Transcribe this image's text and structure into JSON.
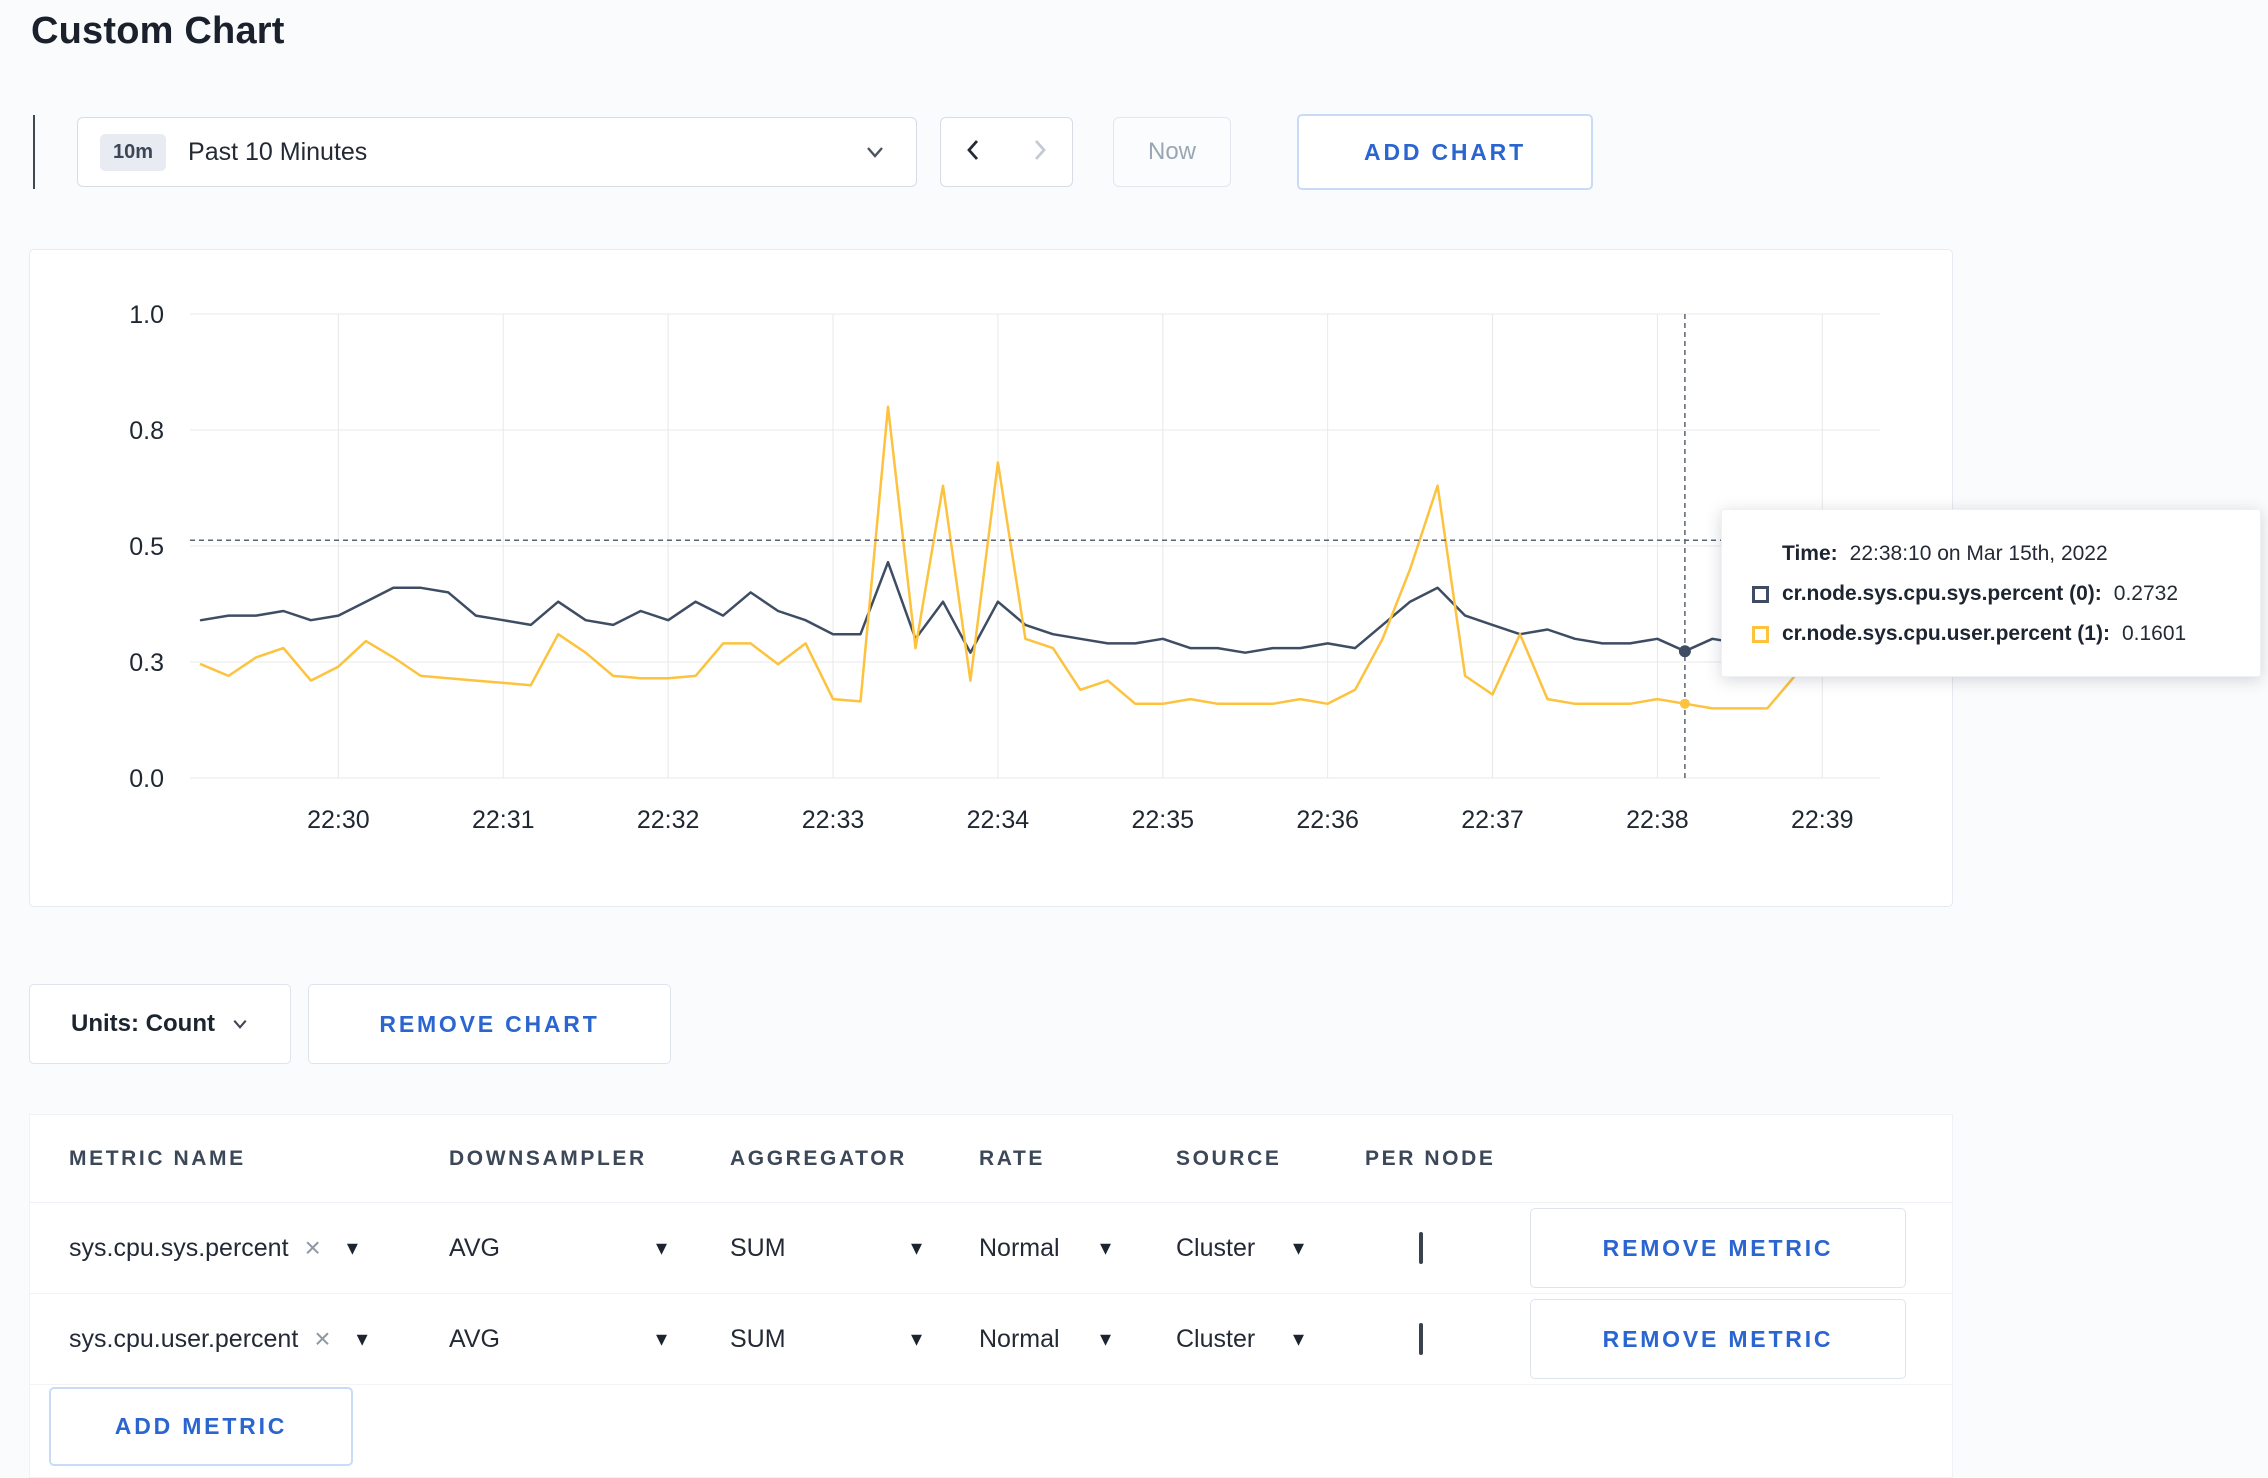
{
  "page": {
    "title": "Custom Chart",
    "accent": "#2a65d0",
    "background": "#fafbfc"
  },
  "icons": {
    "caret_down": "▾",
    "clear": "×"
  },
  "toolbar": {
    "time_window": {
      "badge": "10m",
      "label": "Past 10 Minutes"
    },
    "now_label": "Now",
    "add_chart_label": "ADD CHART"
  },
  "tooltip": {
    "time_label": "Time:",
    "time_value": "22:38:10 on Mar 15th, 2022",
    "series": [
      {
        "label": "cr.node.sys.cpu.sys.percent (0):",
        "value": "0.2732",
        "color": "#3e4d63"
      },
      {
        "label": "cr.node.sys.cpu.user.percent (1):",
        "value": "0.1601",
        "color": "#fdc23e"
      }
    ]
  },
  "units": {
    "label": "Units: Count",
    "remove_chart_label": "REMOVE CHART"
  },
  "metrics_table": {
    "headers": [
      "METRIC NAME",
      "DOWNSAMPLER",
      "AGGREGATOR",
      "RATE",
      "SOURCE",
      "PER NODE"
    ],
    "rows": [
      {
        "name": "sys.cpu.sys.percent",
        "downsampler": "AVG",
        "aggregator": "SUM",
        "rate": "Normal",
        "source": "Cluster",
        "per_node_checked": false,
        "remove_label": "REMOVE METRIC"
      },
      {
        "name": "sys.cpu.user.percent",
        "downsampler": "AVG",
        "aggregator": "SUM",
        "rate": "Normal",
        "source": "Cluster",
        "per_node_checked": false,
        "remove_label": "REMOVE METRIC"
      }
    ],
    "add_metric_label": "ADD METRIC"
  },
  "chart_data": {
    "type": "line",
    "x_domain_minutes": [
      29.1,
      39.35
    ],
    "y_domain": [
      0,
      1
    ],
    "x_start_minute": 29.1667,
    "x_step_minute": 0.166667,
    "grid": true,
    "legend_position": "tooltip",
    "y_ticks": [
      {
        "v": 0.0,
        "label": "0.0"
      },
      {
        "v": 0.25,
        "label": "0.3"
      },
      {
        "v": 0.5,
        "label": "0.5"
      },
      {
        "v": 0.75,
        "label": "0.8"
      },
      {
        "v": 1.0,
        "label": "1.0"
      }
    ],
    "x_ticks": [
      {
        "v": 30,
        "label": "22:30"
      },
      {
        "v": 31,
        "label": "22:31"
      },
      {
        "v": 32,
        "label": "22:32"
      },
      {
        "v": 33,
        "label": "22:33"
      },
      {
        "v": 34,
        "label": "22:34"
      },
      {
        "v": 35,
        "label": "22:35"
      },
      {
        "v": 36,
        "label": "22:36"
      },
      {
        "v": 37,
        "label": "22:37"
      },
      {
        "v": 38,
        "label": "22:38"
      },
      {
        "v": 39,
        "label": "22:39"
      }
    ],
    "series": [
      {
        "name": "cr.node.sys.cpu.sys.percent",
        "color": "#3e4d63",
        "values": [
          0.34,
          0.35,
          0.35,
          0.36,
          0.34,
          0.35,
          0.38,
          0.41,
          0.41,
          0.4,
          0.35,
          0.34,
          0.33,
          0.38,
          0.34,
          0.33,
          0.36,
          0.34,
          0.38,
          0.35,
          0.4,
          0.36,
          0.34,
          0.31,
          0.31,
          0.465,
          0.3,
          0.38,
          0.27,
          0.38,
          0.33,
          0.31,
          0.3,
          0.29,
          0.29,
          0.3,
          0.28,
          0.28,
          0.27,
          0.28,
          0.28,
          0.29,
          0.28,
          0.33,
          0.38,
          0.41,
          0.35,
          0.33,
          0.31,
          0.32,
          0.3,
          0.29,
          0.29,
          0.3,
          0.2732,
          0.3,
          0.29,
          0.29,
          0.3,
          0.31,
          0.3
        ]
      },
      {
        "name": "cr.node.sys.cpu.user.percent",
        "color": "#fdc23e",
        "values": [
          0.245,
          0.22,
          0.26,
          0.28,
          0.21,
          0.24,
          0.295,
          0.26,
          0.22,
          0.215,
          0.21,
          0.205,
          0.2,
          0.31,
          0.27,
          0.22,
          0.215,
          0.215,
          0.22,
          0.29,
          0.29,
          0.245,
          0.29,
          0.17,
          0.165,
          0.8,
          0.28,
          0.63,
          0.21,
          0.68,
          0.3,
          0.28,
          0.19,
          0.21,
          0.16,
          0.16,
          0.17,
          0.16,
          0.16,
          0.16,
          0.17,
          0.16,
          0.19,
          0.3,
          0.45,
          0.63,
          0.22,
          0.18,
          0.31,
          0.17,
          0.16,
          0.16,
          0.16,
          0.17,
          0.1601,
          0.15,
          0.15,
          0.15,
          0.22,
          0.31,
          0.24
        ]
      }
    ],
    "crosshair": {
      "x_minute": 38.1667,
      "y_value": 0.5125
    }
  }
}
